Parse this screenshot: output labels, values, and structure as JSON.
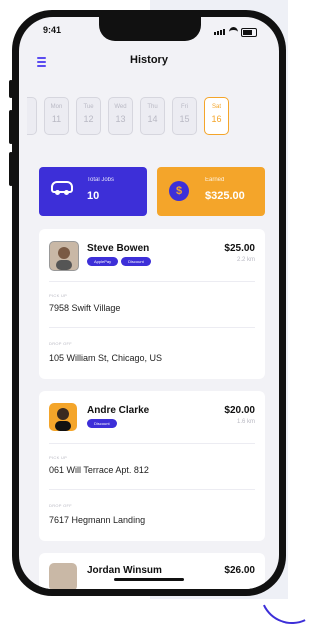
{
  "status": {
    "time": "9:41"
  },
  "header": {
    "title": "History",
    "menu_icon": "hamburger-icon"
  },
  "days": [
    {
      "name": "",
      "num": "",
      "state": "partial"
    },
    {
      "name": "Mon",
      "num": "11",
      "state": "inactive"
    },
    {
      "name": "Tue",
      "num": "12",
      "state": "inactive"
    },
    {
      "name": "Wed",
      "num": "13",
      "state": "inactive"
    },
    {
      "name": "Thu",
      "num": "14",
      "state": "inactive"
    },
    {
      "name": "Fri",
      "num": "15",
      "state": "inactive"
    },
    {
      "name": "Sat",
      "num": "16",
      "state": "active"
    }
  ],
  "stats": {
    "jobs": {
      "label": "Total Jobs",
      "value": "10",
      "icon": "car-icon"
    },
    "earned": {
      "label": "Earned",
      "value": "$325.00",
      "icon": "dollar-coin-icon"
    }
  },
  "colors": {
    "primary": "#3d2fd8",
    "accent": "#f4a52a",
    "background": "#f2f2f6"
  },
  "rides": [
    {
      "name": "Steve Bowen",
      "tags": [
        "ApplePay",
        "Discount"
      ],
      "price": "$25.00",
      "distance": "2.2 km",
      "pickup_label": "PICK UP",
      "pickup": "7958 Swift Village",
      "dropoff_label": "DROP OFF",
      "dropoff": "105 William St, Chicago, US"
    },
    {
      "name": "Andre Clarke",
      "tags": [
        "Discount"
      ],
      "price": "$20.00",
      "distance": "1.6 km",
      "pickup_label": "PICK UP",
      "pickup": "061 Will Terrace Apt. 812",
      "dropoff_label": "DROP OFF",
      "dropoff": "7617 Hegmann Landing"
    },
    {
      "name": "Jordan Winsum",
      "price": "$26.00"
    }
  ]
}
